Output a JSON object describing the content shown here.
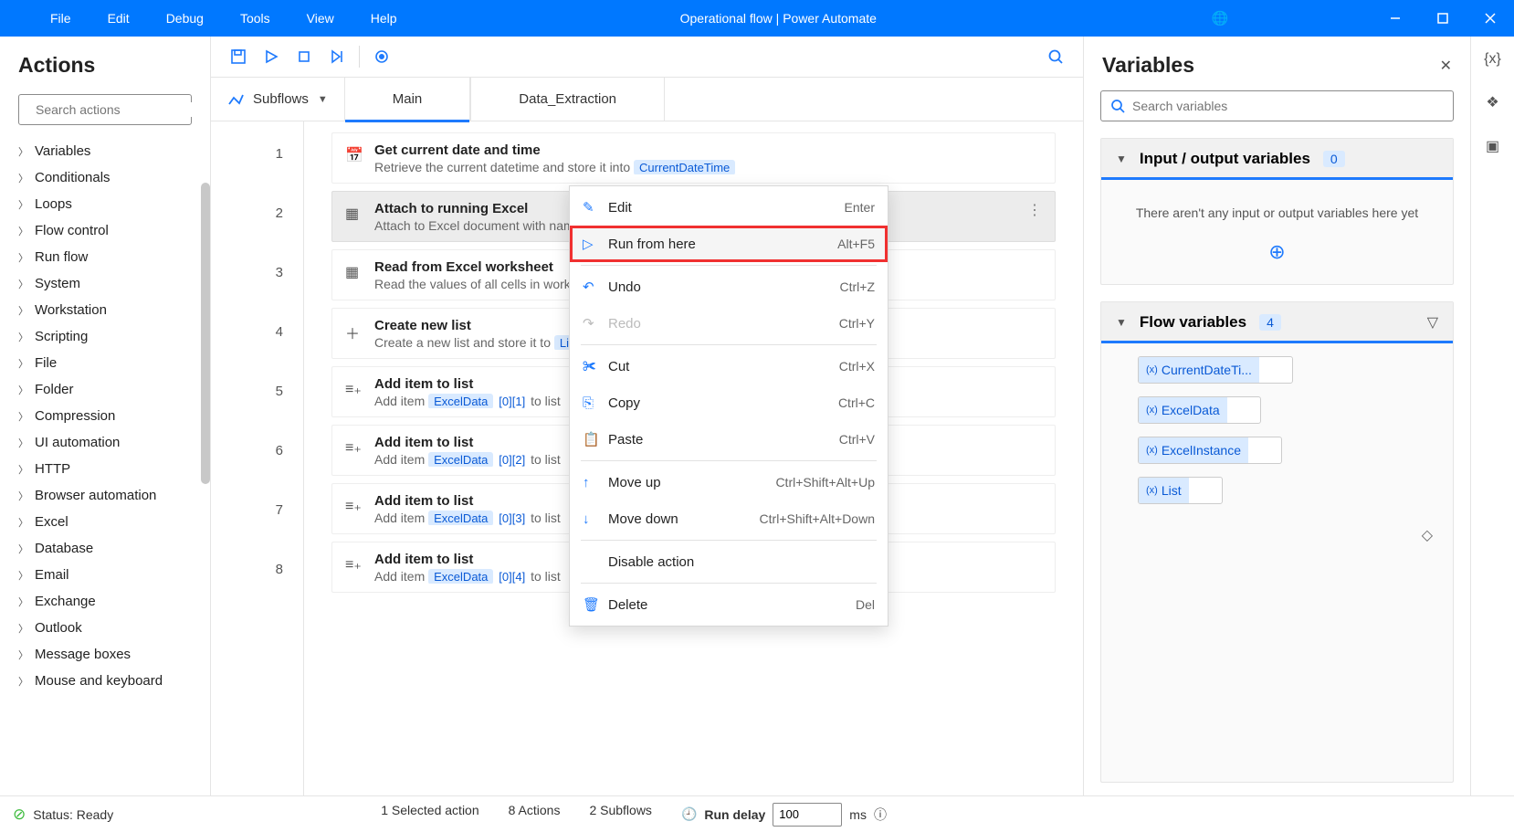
{
  "titlebar": {
    "menus": [
      "File",
      "Edit",
      "Debug",
      "Tools",
      "View",
      "Help"
    ],
    "title": "Operational flow | Power Automate"
  },
  "actionsPanel": {
    "heading": "Actions",
    "searchPlaceholder": "Search actions",
    "categories": [
      "Variables",
      "Conditionals",
      "Loops",
      "Flow control",
      "Run flow",
      "System",
      "Workstation",
      "Scripting",
      "File",
      "Folder",
      "Compression",
      "UI automation",
      "HTTP",
      "Browser automation",
      "Excel",
      "Database",
      "Email",
      "Exchange",
      "Outlook",
      "Message boxes",
      "Mouse and keyboard"
    ]
  },
  "tabs": {
    "subflowsLabel": "Subflows",
    "items": [
      "Main",
      "Data_Extraction"
    ],
    "active": 0
  },
  "steps": [
    {
      "n": 1,
      "icon": "📅",
      "title": "Get current date and time",
      "pre": "Retrieve the current datetime and store it into ",
      "token": "CurrentDateTime",
      "post": ""
    },
    {
      "n": 2,
      "icon": "▦",
      "title": "Attach to running Excel",
      "pre": "Attach to Excel document with nam",
      "token": "",
      "post": "",
      "selected": true
    },
    {
      "n": 3,
      "icon": "▦",
      "title": "Read from Excel worksheet",
      "pre": "Read the values of all cells in work",
      "token": "",
      "post": ""
    },
    {
      "n": 4,
      "icon": "＋",
      "title": "Create new list",
      "pre": "Create a new list and store it to ",
      "token": "Li",
      "post": ""
    },
    {
      "n": 5,
      "icon": "≡₊",
      "title": "Add item to list",
      "pre": "Add item ",
      "token": "ExcelData",
      "idx": "[0][1]",
      "post": " to list"
    },
    {
      "n": 6,
      "icon": "≡₊",
      "title": "Add item to list",
      "pre": "Add item ",
      "token": "ExcelData",
      "idx": "[0][2]",
      "post": " to list"
    },
    {
      "n": 7,
      "icon": "≡₊",
      "title": "Add item to list",
      "pre": "Add item ",
      "token": "ExcelData",
      "idx": "[0][3]",
      "post": " to list"
    },
    {
      "n": 8,
      "icon": "≡₊",
      "title": "Add item to list",
      "pre": "Add item ",
      "token": "ExcelData",
      "idx": "[0][4]",
      "post": " to list"
    }
  ],
  "contextMenu": [
    {
      "icon": "✎",
      "label": "Edit",
      "shortcut": "Enter"
    },
    {
      "icon": "▷",
      "label": "Run from here",
      "shortcut": "Alt+F5",
      "highlight": true
    },
    {
      "sep": true
    },
    {
      "icon": "↶",
      "label": "Undo",
      "shortcut": "Ctrl+Z"
    },
    {
      "icon": "↷",
      "label": "Redo",
      "shortcut": "Ctrl+Y",
      "disabled": true
    },
    {
      "sep": true
    },
    {
      "icon": "✀",
      "label": "Cut",
      "shortcut": "Ctrl+X"
    },
    {
      "icon": "⎘",
      "label": "Copy",
      "shortcut": "Ctrl+C"
    },
    {
      "icon": "📋",
      "label": "Paste",
      "shortcut": "Ctrl+V"
    },
    {
      "sep": true
    },
    {
      "icon": "↑",
      "label": "Move up",
      "shortcut": "Ctrl+Shift+Alt+Up"
    },
    {
      "icon": "↓",
      "label": "Move down",
      "shortcut": "Ctrl+Shift+Alt+Down"
    },
    {
      "sep": true
    },
    {
      "icon": "",
      "label": "Disable action",
      "shortcut": ""
    },
    {
      "sep": true
    },
    {
      "icon": "🗑",
      "label": "Delete",
      "shortcut": "Del"
    }
  ],
  "varsPanel": {
    "heading": "Variables",
    "searchPlaceholder": "Search variables",
    "ioTitle": "Input / output variables",
    "ioCount": "0",
    "ioEmpty": "There aren't any input or output variables here yet",
    "flowTitle": "Flow variables",
    "flowCount": "4",
    "chips": [
      "CurrentDateTi...",
      "ExcelData",
      "ExcelInstance",
      "List"
    ]
  },
  "status": {
    "ready": "Status: Ready",
    "selected": "1 Selected action",
    "actions": "8 Actions",
    "subflows": "2 Subflows",
    "delayLabel": "Run delay",
    "delayValue": "100",
    "delayUnit": "ms"
  }
}
